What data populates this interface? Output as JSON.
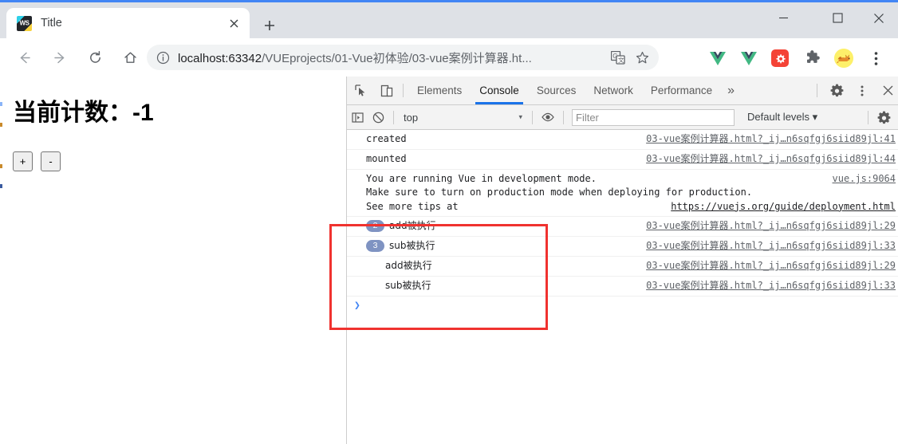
{
  "browser": {
    "tab": {
      "title": "Title",
      "favicon": "webstorm-icon",
      "close_icon": "close-icon"
    },
    "new_tab_icon": "plus-icon",
    "window_controls": {
      "minimize": "minimize-icon",
      "maximize": "maximize-icon",
      "close": "close-icon"
    },
    "nav": {
      "back": "back-arrow-icon",
      "forward": "forward-arrow-icon",
      "reload": "reload-icon",
      "home": "home-icon"
    },
    "omnibox": {
      "info_icon": "info-circle-icon",
      "url_host": "localhost:63342",
      "url_path": "/VUEprojects/01-Vue初体验/03-vue案例计算器.ht...",
      "translate_icon": "translate-icon",
      "star_icon": "star-icon"
    },
    "extensions": [
      {
        "name": "vue-devtools-icon-1",
        "label": "V"
      },
      {
        "name": "vue-devtools-icon-2",
        "label": "V"
      },
      {
        "name": "settings-extension-icon",
        "label": ""
      },
      {
        "name": "puzzle-extensions-icon",
        "label": ""
      },
      {
        "name": "profile-avatar",
        "label": ""
      }
    ],
    "menu_icon": "three-dot-menu-icon",
    "accent_color": "#4285f4"
  },
  "page": {
    "counter_label": "当前计数：-1",
    "increment_button": "+",
    "decrement_button": "-"
  },
  "devtools": {
    "inspect_icon": "inspect-element-icon",
    "device_icon": "device-toolbar-icon",
    "tabs": [
      {
        "label": "Elements",
        "active": false
      },
      {
        "label": "Console",
        "active": true
      },
      {
        "label": "Sources",
        "active": false
      },
      {
        "label": "Network",
        "active": false
      },
      {
        "label": "Performance",
        "active": false
      }
    ],
    "overflow_label": "»",
    "settings_icon": "gear-icon",
    "more_icon": "three-dot-menu-icon",
    "close_icon": "close-icon",
    "active_tab_underline_color": "#1a73e8",
    "console_bar": {
      "sidebar_icon": "console-sidebar-icon",
      "clear_icon": "clear-console-icon",
      "context": "top",
      "context_caret": "▾",
      "eye_icon": "live-expression-icon",
      "filter_placeholder": "Filter",
      "levels_label": "Default levels",
      "levels_caret": "▾",
      "settings_icon": "gear-icon"
    },
    "messages": [
      {
        "badge": null,
        "text": "created",
        "source": "03-vue案例计算器.html?_ij…n6sqfgj6siid89jl:41",
        "highlighted": false
      },
      {
        "badge": null,
        "text": "mounted",
        "source": "03-vue案例计算器.html?_ij…n6sqfgj6siid89jl:44",
        "highlighted": false
      },
      {
        "badge": null,
        "text": "You are running Vue in development mode.",
        "text2": "Make sure to turn on production mode when deploying for production.",
        "text3_prefix": "See more tips at ",
        "text3_link": "https://vuejs.org/guide/deployment.html",
        "source": "vue.js:9064",
        "highlighted": false
      },
      {
        "badge": "2",
        "text": "add被执行",
        "source": "03-vue案例计算器.html?_ij…n6sqfgj6siid89jl:29",
        "highlighted": true
      },
      {
        "badge": "3",
        "text": "sub被执行",
        "source": "03-vue案例计算器.html?_ij…n6sqfgj6siid89jl:33",
        "highlighted": true
      },
      {
        "badge": null,
        "text": "add被执行",
        "source": "03-vue案例计算器.html?_ij…n6sqfgj6siid89jl:29",
        "highlighted": true
      },
      {
        "badge": null,
        "text": "sub被执行",
        "source": "03-vue案例计算器.html?_ij…n6sqfgj6siid89jl:33",
        "highlighted": true
      }
    ],
    "prompt_caret": "❯"
  },
  "annotation": {
    "highlight_color": "#f0322f",
    "badge_color": "#7f93c2"
  }
}
